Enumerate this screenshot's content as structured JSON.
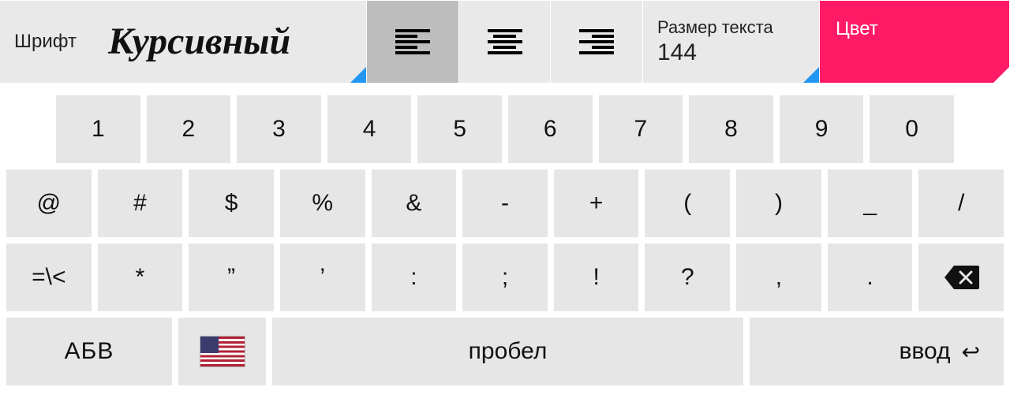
{
  "toolbar": {
    "font": {
      "label": "Шрифт",
      "name": "Курсивный"
    },
    "align": {
      "active": 0
    },
    "size": {
      "label": "Размер текста",
      "value": "144"
    },
    "color": {
      "label": "Цвет",
      "value": "#ff1a66"
    }
  },
  "keyboard": {
    "row1": [
      "1",
      "2",
      "3",
      "4",
      "5",
      "6",
      "7",
      "8",
      "9",
      "0"
    ],
    "row2": [
      "@",
      "#",
      "$",
      "%",
      "&",
      "-",
      "+",
      "(",
      ")",
      "_",
      "/"
    ],
    "row3": [
      "=\\<",
      "*",
      "”",
      "’",
      ":",
      ";",
      "!",
      "?",
      ",",
      "."
    ],
    "letters_label": "АБВ",
    "space_label": "пробел",
    "enter_label": "ввод"
  }
}
